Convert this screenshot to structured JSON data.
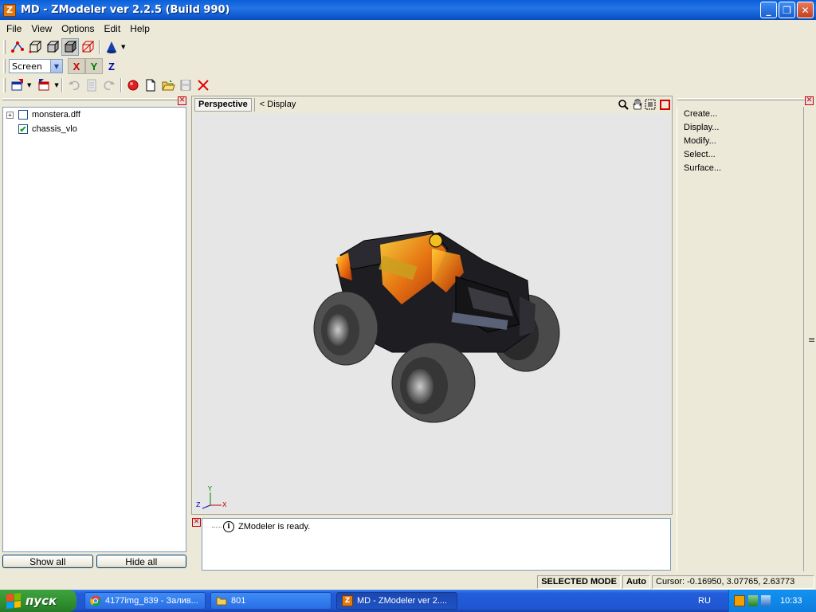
{
  "window": {
    "title": "MD - ZModeler ver 2.2.5 (Build 990)",
    "app_icon_letter": "Z",
    "minimize_glyph": "_",
    "restore_glyph": "❐",
    "close_glyph": "✕"
  },
  "menu": [
    "File",
    "View",
    "Options",
    "Edit",
    "Help"
  ],
  "toolbar2": {
    "coord_mode": "Screen",
    "axis_x": "X",
    "axis_y": "Y",
    "axis_z": "Z"
  },
  "tree": {
    "items": [
      {
        "label": "monstera.dff",
        "checked": false,
        "expandable": true,
        "expander": "+"
      },
      {
        "label": "chassis_vlo",
        "checked": true,
        "expandable": false,
        "check_glyph": "✔"
      }
    ]
  },
  "left_buttons": {
    "show_all": "Show all",
    "hide_all": "Hide all"
  },
  "viewport": {
    "tab": "Perspective",
    "display": "<  Display",
    "axis_labels": {
      "z": "Z",
      "y": "Y",
      "x": "X"
    }
  },
  "log": {
    "message": "ZModeler is ready.",
    "icon_glyph": "i"
  },
  "right_panel": {
    "items": [
      "Create...",
      "Display...",
      "Modify...",
      "Select...",
      "Surface..."
    ],
    "splitter_glyph": "≡"
  },
  "status": {
    "mode": "SELECTED MODE",
    "auto": "Auto",
    "cursor": "Cursor: -0.16950, 3.07765, 2.63773"
  },
  "taskbar": {
    "start": "пуск",
    "tasks": [
      {
        "label": "4177img_839 - Залив...",
        "icon": "chrome-icon"
      },
      {
        "label": "801",
        "icon": "folder-icon"
      },
      {
        "label": "MD - ZModeler ver 2....",
        "icon": "zmodeler-icon",
        "active": true
      }
    ],
    "language": "RU",
    "clock": "10:33"
  },
  "colors": {
    "titlebar": "#0a5fd8",
    "viewport_bg": "#e6e6e6",
    "taskbar": "#245edb",
    "start": "#2f8f2f"
  }
}
